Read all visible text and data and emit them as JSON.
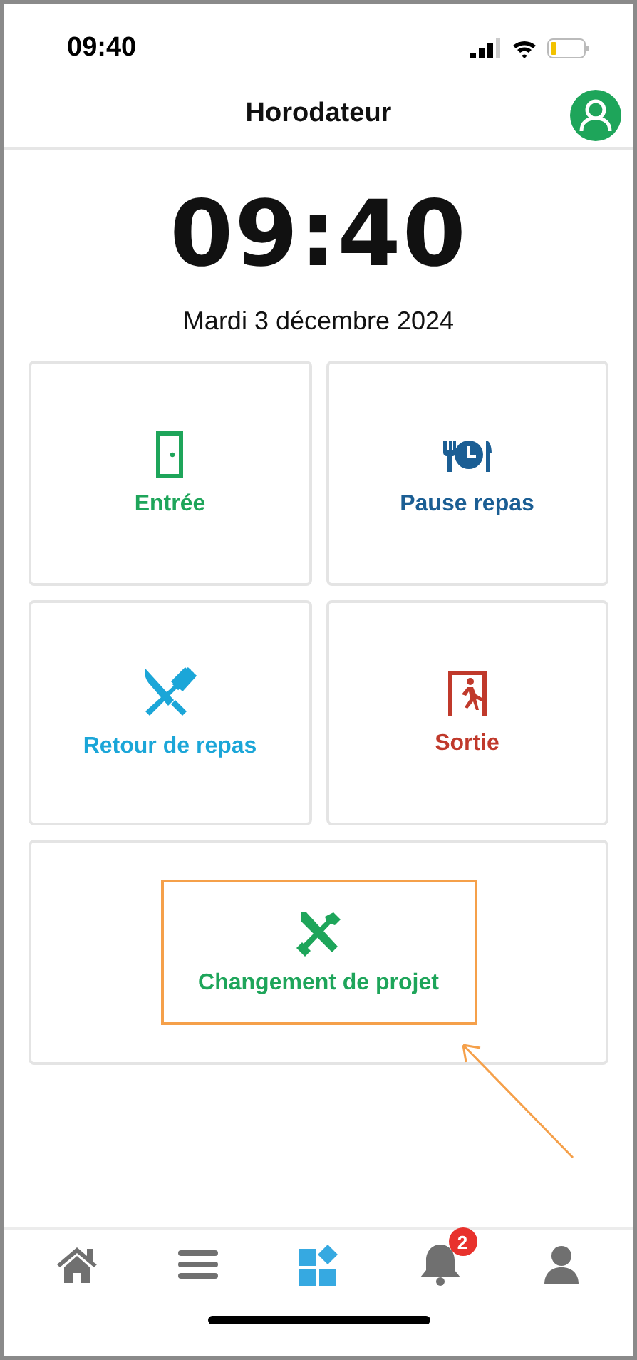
{
  "status_bar": {
    "time": "09:40"
  },
  "header": {
    "title": "Horodateur"
  },
  "clock": {
    "time": "09:40",
    "date": "Mardi 3 décembre 2024"
  },
  "actions": [
    {
      "kind": "entry",
      "label": "Entrée",
      "color": "#1ea55a"
    },
    {
      "kind": "meal_break",
      "label": "Pause repas",
      "color": "#1b5e94"
    },
    {
      "kind": "meal_return",
      "label": "Retour de repas",
      "color": "#1ba6d8"
    },
    {
      "kind": "exit",
      "label": "Sortie",
      "color": "#c0392b"
    },
    {
      "kind": "project",
      "label": "Changement de projet",
      "color": "#1ea55a",
      "highlighted": true
    }
  ],
  "tab_bar": [
    {
      "kind": "home",
      "selected": false
    },
    {
      "kind": "menu",
      "selected": false
    },
    {
      "kind": "apps",
      "selected": true
    },
    {
      "kind": "notifications",
      "selected": false,
      "badge": "2"
    },
    {
      "kind": "profile",
      "selected": false
    }
  ]
}
